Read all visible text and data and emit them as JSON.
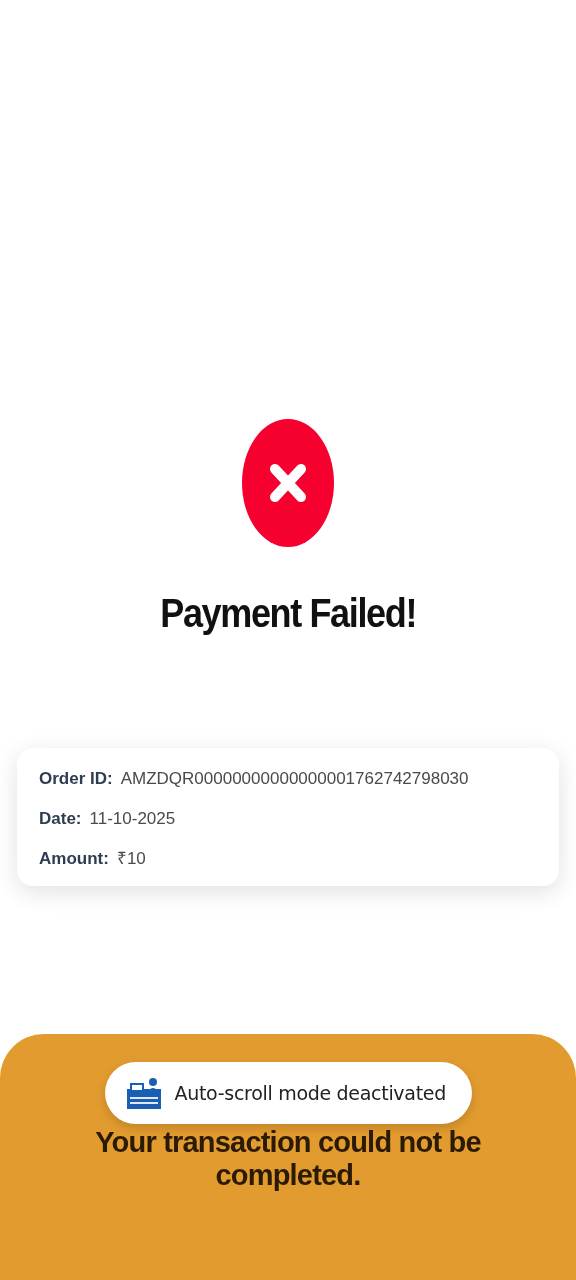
{
  "status_icon": {
    "kind": "error"
  },
  "title": "Payment Failed!",
  "details": [
    {
      "label": "Order ID:",
      "value": "AMZDQR00000000000000001762742798030"
    },
    {
      "label": "Date:",
      "value": "11-10-2025"
    },
    {
      "label": "Amount:",
      "value": "₹10"
    }
  ],
  "toast": {
    "text": "Auto-scroll mode deactivated"
  },
  "message": "Your transaction could not be completed."
}
